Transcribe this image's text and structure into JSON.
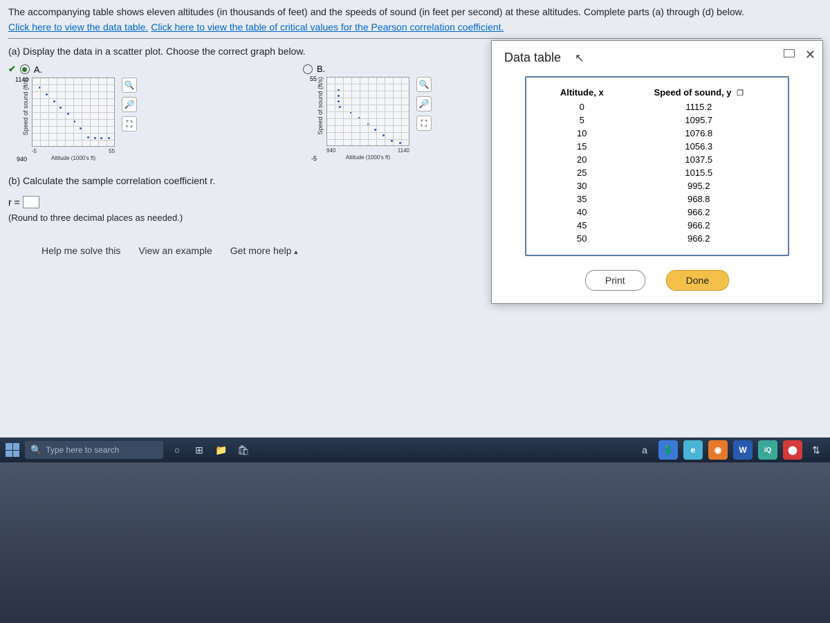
{
  "problem": {
    "intro": "The accompanying table shows eleven altitudes (in thousands of feet) and the speeds of sound (in feet per second) at these altitudes. Complete parts (a) through (d) below.",
    "link1": "Click here to view the data table.",
    "link2": "Click here to view the table of critical values for the Pearson correlation coefficient."
  },
  "partA": {
    "heading": "(a) Display the data in a scatter plot. Choose the correct graph below.",
    "optionA": "A.",
    "optionB": "B.",
    "graphA": {
      "yTop": "1140",
      "yBot": "940",
      "xLeft": "-5",
      "xRight": "55",
      "xCaption": "Altitude (1000's ft)",
      "yLabel": "Speed of sound (ft/s)"
    },
    "graphB": {
      "yTop": "55",
      "yBot": "-5",
      "xLeft": "940",
      "xRight": "1140",
      "xCaption": "Altitude (1000's ft)",
      "yLabel": "Speed of sound (ft/s)"
    }
  },
  "partB": {
    "heading": "(b) Calculate the sample correlation coefficient r.",
    "rLabel": "r =",
    "roundNote": "(Round to three decimal places as needed.)"
  },
  "popup": {
    "title": "Data table",
    "headers": {
      "x": "Altitude, x",
      "y": "Speed of sound, y"
    },
    "rows": [
      {
        "x": "0",
        "y": "1115.2"
      },
      {
        "x": "5",
        "y": "1095.7"
      },
      {
        "x": "10",
        "y": "1076.8"
      },
      {
        "x": "15",
        "y": "1056.3"
      },
      {
        "x": "20",
        "y": "1037.5"
      },
      {
        "x": "25",
        "y": "1015.5"
      },
      {
        "x": "30",
        "y": "995.2"
      },
      {
        "x": "35",
        "y": "968.8"
      },
      {
        "x": "40",
        "y": "966.2"
      },
      {
        "x": "45",
        "y": "966.2"
      },
      {
        "x": "50",
        "y": "966.2"
      }
    ],
    "printLabel": "Print",
    "doneLabel": "Done"
  },
  "helpBar": {
    "solve": "Help me solve this",
    "example": "View an example",
    "moreHelp": "Get more help"
  },
  "taskbar": {
    "searchPlaceholder": "Type here to search"
  },
  "chart_data": [
    {
      "type": "scatter",
      "title": "Option A",
      "xlabel": "Altitude (1000's ft)",
      "ylabel": "Speed of sound (ft/s)",
      "xlim": [
        -5,
        55
      ],
      "ylim": [
        940,
        1140
      ],
      "x": [
        0,
        5,
        10,
        15,
        20,
        25,
        30,
        35,
        40,
        45,
        50
      ],
      "y": [
        1115.2,
        1095.7,
        1076.8,
        1056.3,
        1037.5,
        1015.5,
        995.2,
        968.8,
        966.2,
        966.2,
        966.2
      ]
    },
    {
      "type": "scatter",
      "title": "Option B",
      "xlabel": "Altitude (1000's ft)",
      "ylabel": "Speed of sound (ft/s)",
      "xlim": [
        940,
        1140
      ],
      "ylim": [
        -5,
        55
      ],
      "x": [
        1115.2,
        1095.7,
        1076.8,
        1056.3,
        1037.5,
        1015.5,
        995.2,
        968.8,
        966.2,
        966.2,
        966.2
      ],
      "y": [
        0,
        5,
        10,
        15,
        20,
        25,
        30,
        35,
        40,
        45,
        50
      ]
    }
  ]
}
